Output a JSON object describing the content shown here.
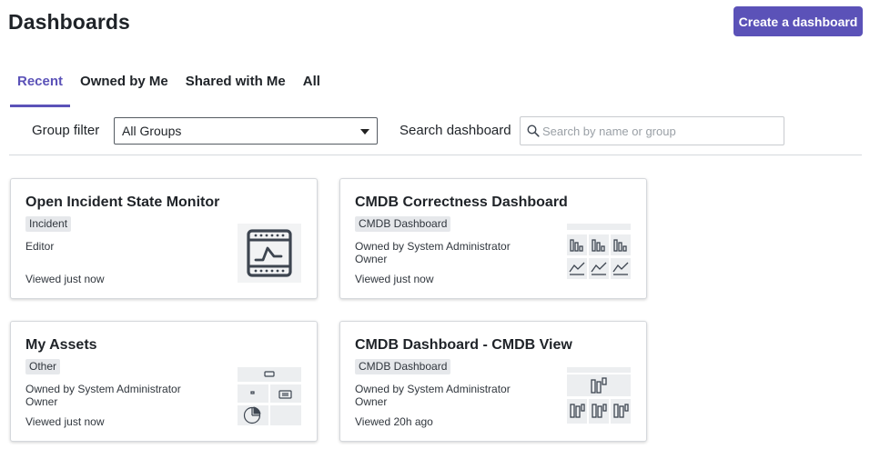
{
  "header": {
    "title": "Dashboards",
    "create_label": "Create a dashboard"
  },
  "tabs": [
    {
      "label": "Recent",
      "active": true
    },
    {
      "label": "Owned by Me",
      "active": false
    },
    {
      "label": "Shared with Me",
      "active": false
    },
    {
      "label": "All",
      "active": false
    }
  ],
  "filters": {
    "group_label": "Group filter",
    "group_value": "All Groups",
    "search_label": "Search dashboard",
    "search_placeholder": "Search by name or group"
  },
  "cards": [
    {
      "title": "Open Incident State Monitor",
      "tag": "Incident",
      "meta1": "Editor",
      "meta2": "",
      "viewed": "Viewed just now",
      "thumbnail": "line-chart-window-icon"
    },
    {
      "title": "CMDB Correctness Dashboard",
      "tag": "CMDB Dashboard",
      "meta1": "Owned by System Administrator",
      "meta2": "Owner",
      "viewed": "Viewed just now",
      "thumbnail": "bar-and-line-grid-icon"
    },
    {
      "title": "My Assets",
      "tag": "Other",
      "meta1": "Owned by System Administrator",
      "meta2": "Owner",
      "viewed": "Viewed just now",
      "thumbnail": "pie-and-list-icon"
    },
    {
      "title": "CMDB Dashboard - CMDB View",
      "tag": "CMDB Dashboard",
      "meta1": "Owned by System Administrator",
      "meta2": "Owner",
      "viewed": "Viewed 20h ago",
      "thumbnail": "bar-grid-icon"
    }
  ],
  "colors": {
    "accent": "#5b52b8",
    "tag_bg": "#e6e8eb",
    "thumb_bg": "#f2f3f4",
    "icon": "#3d4550"
  }
}
